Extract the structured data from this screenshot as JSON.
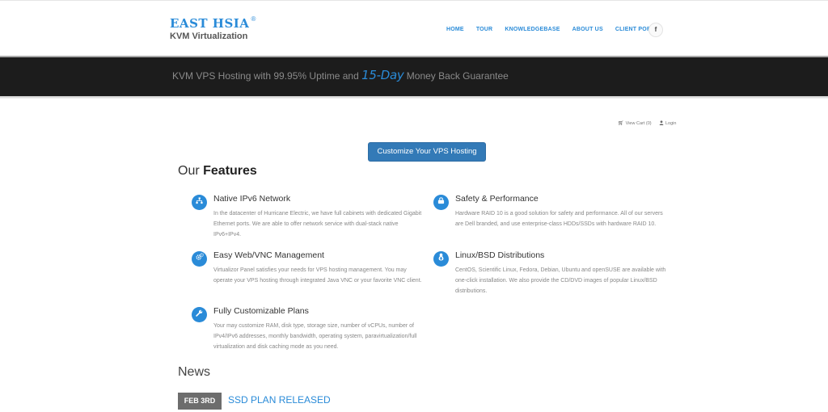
{
  "logo": {
    "title": "EAST HSIA",
    "reg_mark": "®",
    "subtitle": "KVM Virtualization"
  },
  "nav": {
    "items": [
      {
        "label": "HOME"
      },
      {
        "label": "TOUR"
      },
      {
        "label": "KNOWLEDGEBASE"
      },
      {
        "label": "ABOUT US"
      },
      {
        "label": "CLIENT PORTAL"
      }
    ],
    "social_label": "f"
  },
  "banner": {
    "text_before": "KVM VPS Hosting with 99.95% Uptime and ",
    "highlight": "15-Day",
    "text_after": " Money Back Guarantee"
  },
  "account": {
    "cart_label": "View Cart (0)",
    "login_label": "Login"
  },
  "cta_label": "Customize Your VPS Hosting",
  "features": {
    "title_light": "Our ",
    "title_bold": "Features",
    "items": [
      {
        "icon": "network-icon",
        "title": "Native IPv6 Network",
        "desc": "In the datacenter of Hurricane Electric, we have full cabinets with dedicated Gigabit Ethernet ports. We are able to offer network service with dual-stack native IPv6+IPv4."
      },
      {
        "icon": "safety-icon",
        "title": "Safety & Performance",
        "desc": "Hardware RAID 10 is a good solution for safety and performance. All of our servers are Dell branded, and use enterprise-class HDDs/SSDs with hardware RAID 10."
      },
      {
        "icon": "gears-icon",
        "title": "Easy Web/VNC Management",
        "desc": "Virtualizor Panel satisfies your needs for VPS hosting management. You may operate your VPS hosting through integrated Java VNC or your favorite VNC client."
      },
      {
        "icon": "linux-icon",
        "title": "Linux/BSD Distributions",
        "desc": "CentOS, Scientific Linux, Fedora, Debian, Ubuntu and openSUSE are available with one-click installation. We also provide the CD/DVD images of popular Linux/BSD distributions."
      },
      {
        "icon": "wrench-icon",
        "title": "Fully Customizable Plans",
        "desc": "Your may customize RAM, disk type, storage size, number of vCPUs, number of IPv4/IPv6 addresses, monthly bandwidth, operating system, paravirtualization/full virtualization and disk caching mode as you need."
      }
    ]
  },
  "news": {
    "title": "News",
    "items": [
      {
        "date": "FEB 3RD",
        "headline": "SSD PLAN RELEASED"
      }
    ]
  },
  "colors": {
    "accent": "#2a8bd8",
    "banner_bg": "#1c1c1c",
    "button": "#337ab7"
  }
}
